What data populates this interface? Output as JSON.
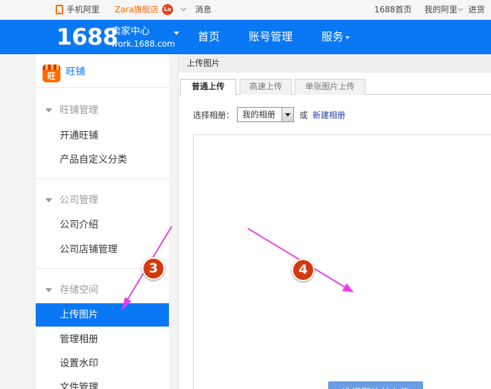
{
  "topbar": {
    "mobile_ali": "手机阿里",
    "zara_store": "Zara旗舰店",
    "store_badge": "Lo",
    "messages": "消息",
    "home_1688": "1688首页",
    "my_ali": "我的阿里",
    "wholesale": "进货"
  },
  "header": {
    "logo_number": "1688",
    "logo_title": "卖家中心",
    "logo_url": "work.1688.com",
    "nav": {
      "home": "首页",
      "account": "账号管理",
      "services": "服务"
    },
    "brand_color": "#0a78f5"
  },
  "sidebar": {
    "wangpu_icon_text": "旺",
    "wangpu_title": "旺铺",
    "sections": {
      "wangpu": "旺铺管理",
      "company": "公司管理",
      "storage": "存储空间"
    },
    "items": {
      "open_wangpu": "开通旺铺",
      "custom_category": "产品自定义分类",
      "company_intro": "公司介绍",
      "company_store": "公司店铺管理",
      "upload_images": "上传图片",
      "manage_albums": "管理相册",
      "watermark": "设置水印",
      "file_manage": "文件管理"
    }
  },
  "main": {
    "breadcrumb": "上传图片",
    "tabs": {
      "normal": "普通上传",
      "fast": "高速上传",
      "single": "单张图片上传"
    },
    "album_label": "选择相册：",
    "album_value": "我的相册",
    "or_text": "或",
    "new_album": "新建相册",
    "upload_button": "选择图片并上传"
  },
  "annotations": {
    "step3": "3",
    "step4": "4",
    "arrow_color": "#e63ee6",
    "badge_color": "#d4390c"
  }
}
